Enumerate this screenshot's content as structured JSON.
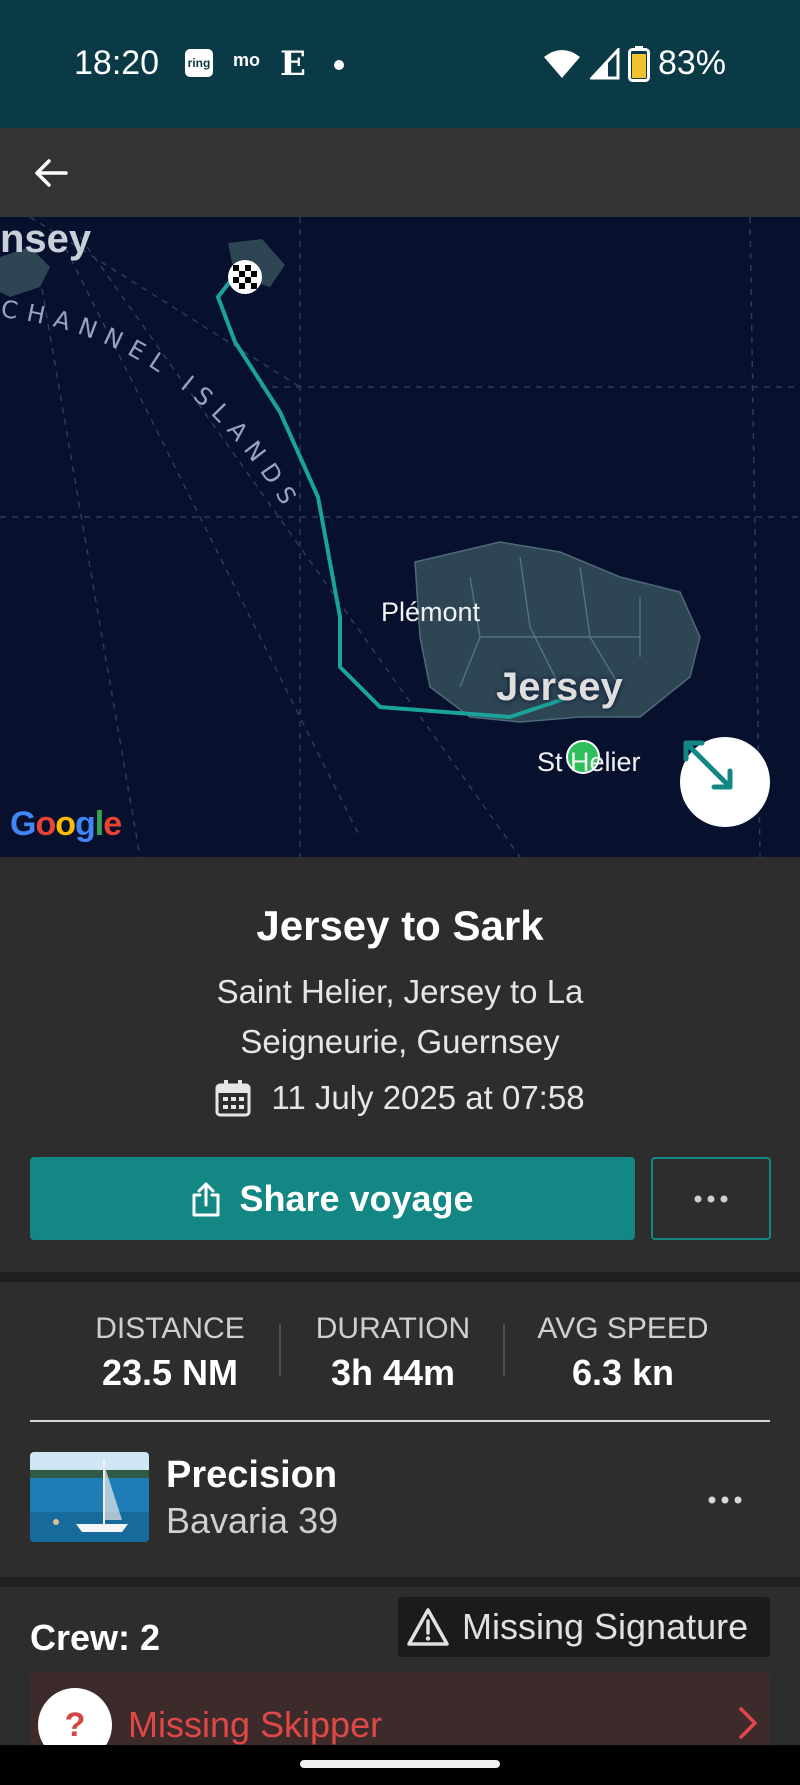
{
  "status_bar": {
    "time": "18:20",
    "ring_label": "ring",
    "mo_label": "mo",
    "e_label": "E",
    "battery_percent": "83%",
    "icons": [
      "ring-app-icon",
      "mo-app-icon",
      "e-app-icon",
      "dot-icon",
      "wifi-icon",
      "signal-icon",
      "battery-icon"
    ]
  },
  "app_bar": {
    "back_icon": "back-arrow-icon"
  },
  "map": {
    "labels": {
      "guernsey_partial": "nsey",
      "channel_islands": "CHANNEL ISLANDS",
      "plemont": "Plémont",
      "jersey": "Jersey",
      "st_helier": "St Helier"
    },
    "google_logo": "Google",
    "expand_icon": "expand-icon",
    "finish_icon": "checkered-flag-icon",
    "start_icon": "start-dot-icon",
    "colors": {
      "sea": "#07112e",
      "land": "#2e4654",
      "track": "#1aa39a",
      "start_dot": "#2fbf5a"
    }
  },
  "voyage": {
    "title": "Jersey to Sark",
    "route": "Saint Helier, Jersey to La Seigneurie, Guernsey",
    "date": "11 July 2025 at 07:58",
    "calendar_icon": "calendar-icon",
    "share_label": "Share voyage",
    "share_icon": "share-icon",
    "more_icon": "more-horizontal-icon"
  },
  "stats": [
    {
      "label": "DISTANCE",
      "value": "23.5 NM"
    },
    {
      "label": "DURATION",
      "value": "3h 44m"
    },
    {
      "label": "AVG SPEED",
      "value": "6.3 kn"
    }
  ],
  "boat": {
    "name": "Precision",
    "model": "Bavaria 39",
    "more_icon": "more-horizontal-icon"
  },
  "crew": {
    "title": "Crew: 2",
    "missing_signature": "Missing Signature",
    "warning_icon": "warning-icon",
    "missing_skipper": "Missing Skipper",
    "skipper_avatar": "?",
    "chevron_icon": "chevron-right-icon"
  },
  "colors": {
    "accent": "#138784",
    "status_bar": "#0a3a46",
    "background": "#2d2d2d",
    "warning_red": "#e04848"
  }
}
